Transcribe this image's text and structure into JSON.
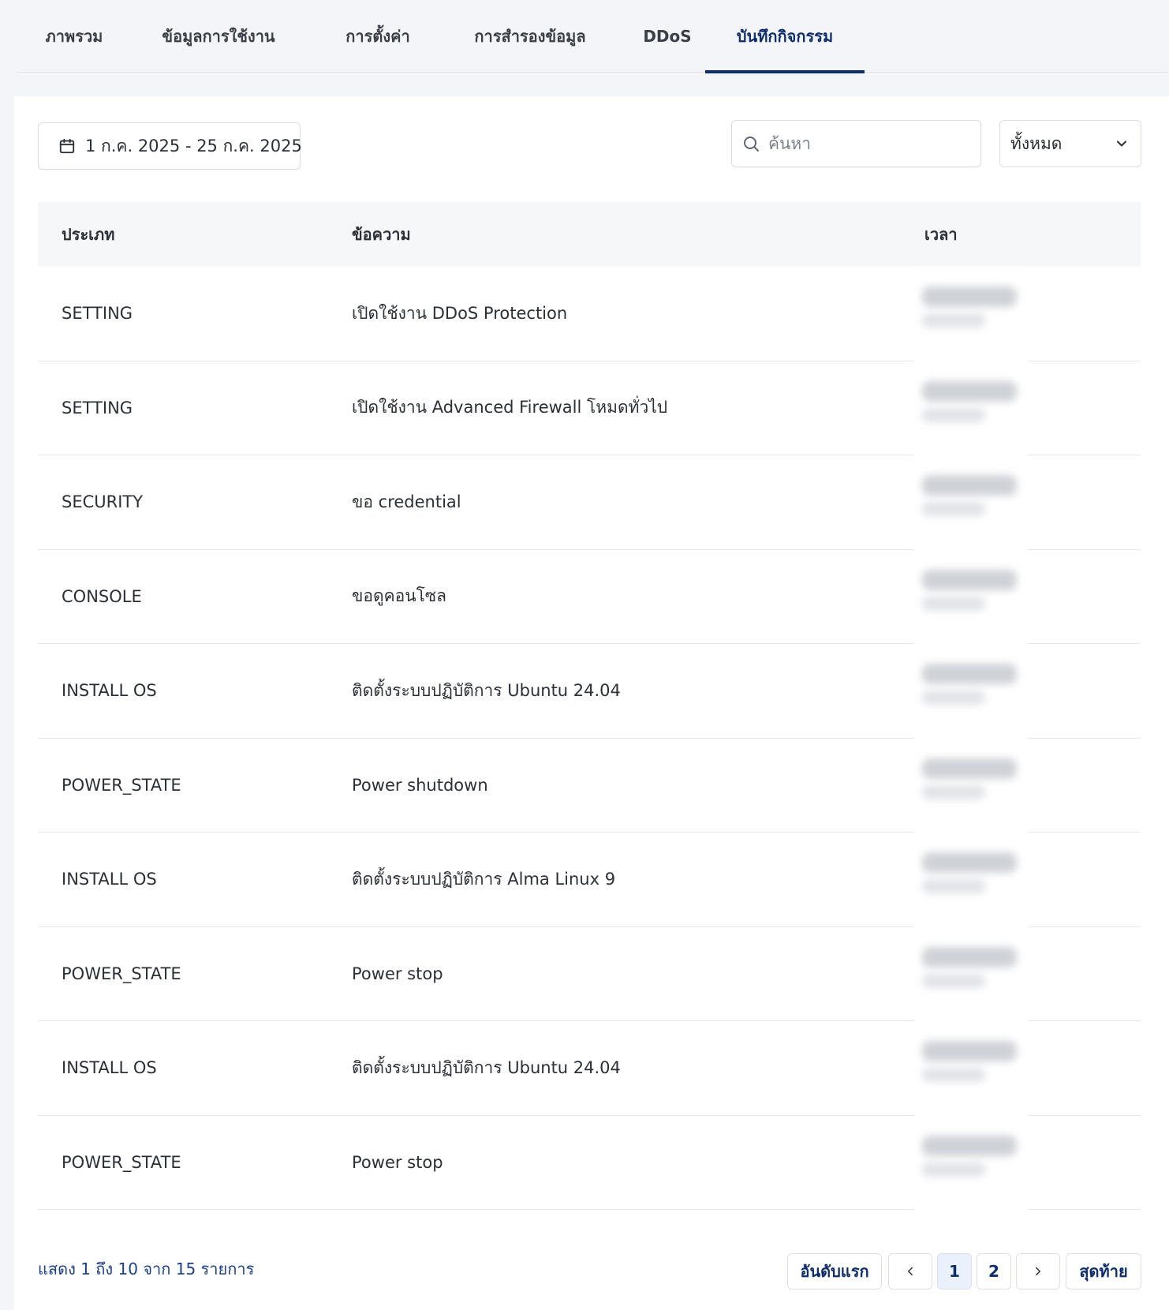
{
  "tabs": [
    {
      "label": "ภาพรวม",
      "active": false
    },
    {
      "label": "ข้อมูลการใช้งาน",
      "active": false
    },
    {
      "label": "การตั้งค่า",
      "active": false
    },
    {
      "label": "การสำรองข้อมูล",
      "active": false
    },
    {
      "label": "DDoS",
      "active": false
    },
    {
      "label": "บันทึกกิจกรรม",
      "active": true
    }
  ],
  "filters": {
    "date_range": "1 ก.ค. 2025 - 25 ก.ค. 2025",
    "search_placeholder": "ค้นหา",
    "search_value": "",
    "type_selected": "ทั้งหมด"
  },
  "table": {
    "columns": [
      "ประเภท",
      "ข้อความ",
      "เวลา"
    ],
    "rows": [
      {
        "type": "SETTING",
        "message": "เปิดใช้งาน DDoS Protection"
      },
      {
        "type": "SETTING",
        "message": "เปิดใช้งาน Advanced Firewall โหมดทั่วไป"
      },
      {
        "type": "SECURITY",
        "message": "ขอ credential"
      },
      {
        "type": "CONSOLE",
        "message": "ขอดูคอนโซล"
      },
      {
        "type": "INSTALL OS",
        "message": "ติดตั้งระบบปฏิบัติการ Ubuntu 24.04"
      },
      {
        "type": "POWER_STATE",
        "message": "Power shutdown"
      },
      {
        "type": "INSTALL OS",
        "message": "ติดตั้งระบบปฏิบัติการ Alma Linux 9"
      },
      {
        "type": "POWER_STATE",
        "message": "Power stop"
      },
      {
        "type": "INSTALL OS",
        "message": "ติดตั้งระบบปฏิบัติการ Ubuntu 24.04"
      },
      {
        "type": "POWER_STATE",
        "message": "Power stop"
      }
    ]
  },
  "footer": {
    "summary": "แสดง 1 ถึง 10 จาก 15 รายการ",
    "first_label": "อันดับแรก",
    "prev_symbol": "‹",
    "pages": [
      "1",
      "2"
    ],
    "current_page": "1",
    "next_symbol": "›",
    "last_label": "สุดท้าย"
  },
  "colors": {
    "accent": "#0e2d6b",
    "page_bg": "#f3f5f9",
    "header_bg": "#f6f7f9",
    "active_page_bg": "#eaf1fd"
  }
}
